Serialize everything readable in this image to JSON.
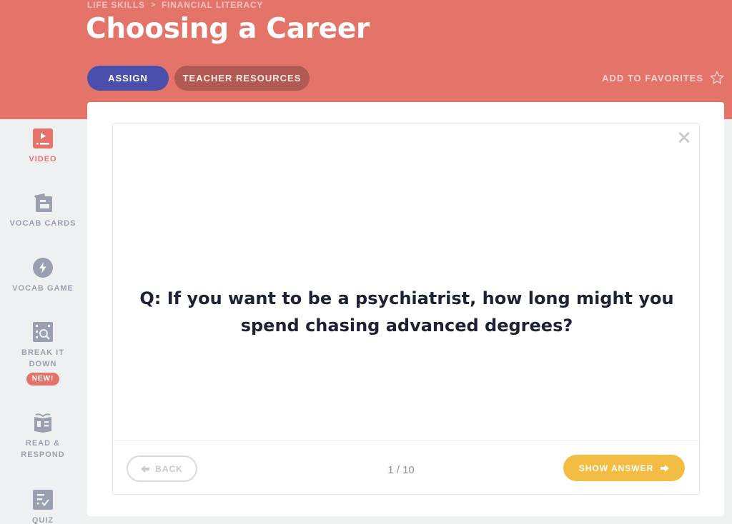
{
  "header": {
    "breadcrumb": [
      "LIFE SKILLS",
      "FINANCIAL LITERACY"
    ],
    "breadcrumb_separator": ">",
    "title": "Choosing a Career",
    "assign_label": "ASSIGN",
    "teacher_resources_label": "TEACHER RESOURCES",
    "favorites_label": "ADD TO FAVORITES",
    "favorites_icon": "star-outline-icon"
  },
  "sidebar": {
    "items": [
      {
        "label": "VIDEO",
        "icon": "video-icon",
        "active": true
      },
      {
        "label": "VOCAB CARDS",
        "icon": "cards-icon",
        "active": false
      },
      {
        "label": "VOCAB GAME",
        "icon": "lightning-icon",
        "active": false
      },
      {
        "label": "BREAK IT DOWN",
        "icon": "magnify-grid-icon",
        "active": false,
        "badge": "NEW!"
      },
      {
        "label": "READ & RESPOND",
        "icon": "book-icon",
        "active": false
      },
      {
        "label": "QUIZ",
        "icon": "quiz-check-icon",
        "active": false
      }
    ]
  },
  "card": {
    "question": "Q: If you want to be a psychiatrist, how long might you spend chasing advanced degrees?",
    "close_icon": "close-icon",
    "back_label": "BACK",
    "counter": "1 / 10",
    "show_answer_label": "SHOW ANSWER"
  },
  "colors": {
    "header_bg": "#e4746a",
    "assign_bg": "#4a4fab",
    "teacher_bg": "#b05a53",
    "answer_bg": "#f3bc42",
    "active_nav": "#e4746a",
    "inactive_nav": "#9aa0b0"
  }
}
